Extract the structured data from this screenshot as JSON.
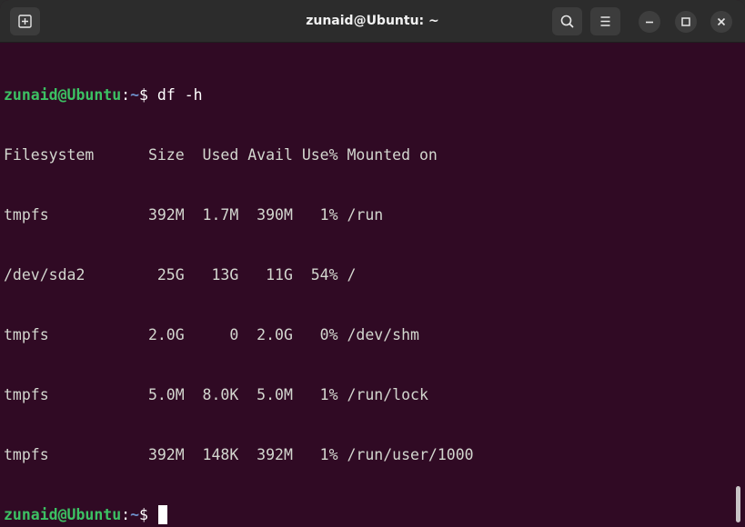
{
  "window": {
    "title": "zunaid@Ubuntu: ~"
  },
  "colors": {
    "terminal_bg": "#300a24",
    "titlebar_bg": "#2c2c2c",
    "prompt_user": "#3cc163",
    "prompt_path": "#6d8fc9",
    "text": "#d3d7cf"
  },
  "icons": {
    "new_tab": "new-tab-icon",
    "search": "search-icon",
    "menu": "hamburger-menu-icon",
    "minimize": "minimize-icon",
    "maximize": "maximize-icon",
    "close": "close-icon"
  },
  "prompt": {
    "user_host": "zunaid@Ubuntu",
    "colon": ":",
    "path": "~",
    "sign": "$ "
  },
  "command": "df -h",
  "output": {
    "header": "Filesystem      Size  Used Avail Use% Mounted on",
    "rows": [
      "tmpfs           392M  1.7M  390M   1% /run",
      "/dev/sda2        25G   13G   11G  54% /",
      "tmpfs           2.0G     0  2.0G   0% /dev/shm",
      "tmpfs           5.0M  8.0K  5.0M   1% /run/lock",
      "tmpfs           392M  148K  392M   1% /run/user/1000"
    ]
  }
}
